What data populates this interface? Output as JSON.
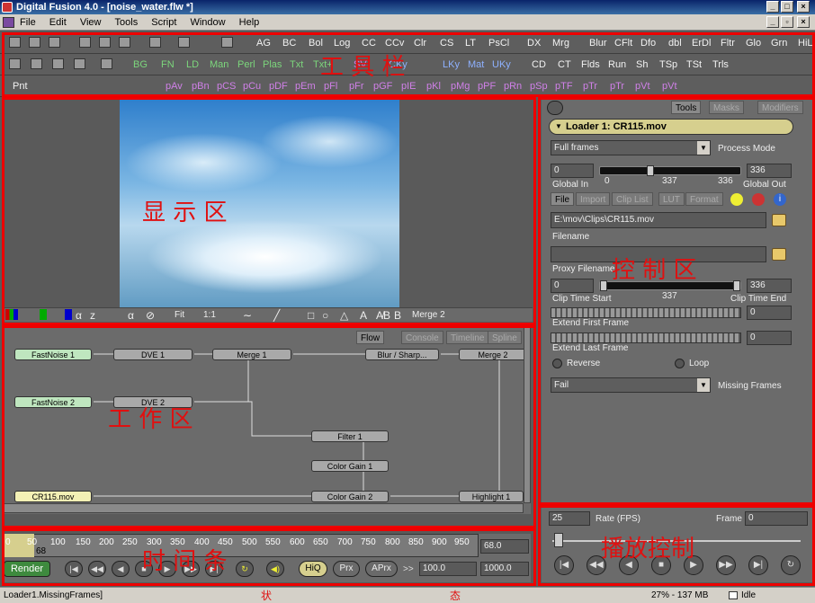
{
  "window": {
    "title": "Digital Fusion 4.0 - [noise_water.flw *]"
  },
  "menu": [
    "File",
    "Edit",
    "View",
    "Tools",
    "Script",
    "Window",
    "Help"
  ],
  "toolbar1": [
    "AG",
    "BC",
    "Bol",
    "Log",
    "CC",
    "CCv",
    "Clr",
    "CS",
    "LT",
    "PsCl",
    "DX",
    "Mrg",
    "Blur",
    "CFlt",
    "Dfo",
    "dbl",
    "ErDl",
    "Fltr",
    "Glo",
    "Grn",
    "HiL"
  ],
  "toolbar2": [
    "BG",
    "FN",
    "LD",
    "Man",
    "Perl",
    "Plas",
    "Txt",
    "Txt+",
    "SV",
    "CKy",
    "LKy",
    "Mat",
    "UKy",
    "CD",
    "CT",
    "Flds",
    "Run",
    "Sh",
    "TSp",
    "TSt",
    "Trls"
  ],
  "toolbar3": [
    "Pnt",
    "pAv",
    "pBn",
    "pCS",
    "pCu",
    "pDF",
    "pEm",
    "pFl",
    "pFr",
    "pGF",
    "pIE",
    "pKl",
    "pMg",
    "pPF",
    "pRn",
    "pSp",
    "pTF",
    "pTr",
    "pTr",
    "pVt",
    "pVt"
  ],
  "annotations": {
    "toolbar": "工  具  栏",
    "viewer": "显    示    区",
    "control": "控  制  区",
    "flow": "工    作    区",
    "timeline": "时    间    条",
    "playback": "播放控制",
    "status": "状",
    "status2": "态"
  },
  "viewer": {
    "zoom": "Fit",
    "ratio": "1:1",
    "node_label": "Merge 2"
  },
  "flow": {
    "tabs": [
      "Flow",
      "Console",
      "Timeline",
      "Spline"
    ],
    "nodes": [
      "FastNoise 1",
      "DVE 1",
      "Merge 1",
      "Blur / Sharp...",
      "Merge 2",
      "FastNoise 2",
      "DVE 2",
      "Filter 1",
      "Color Gain 1",
      "CR115.mov",
      "Color Gain 2",
      "Highlight 1"
    ]
  },
  "control": {
    "tabs": [
      "Tools",
      "Masks",
      "Modifiers"
    ],
    "header": "Loader 1: CR115.mov",
    "process_mode_value": "Full frames",
    "process_mode_label": "Process Mode",
    "global_in_value": "0",
    "global_out_value": "336",
    "global_in_label": "Global In",
    "global_out_label": "Global Out",
    "slider_min": "0",
    "slider_mid": "337",
    "slider_max": "336",
    "subtabs": [
      "File",
      "Import",
      "Clip List",
      "LUT",
      "Format"
    ],
    "filename_value": "E:\\mov\\Clips\\CR115.mov",
    "filename_label": "Filename",
    "proxy_label": "Proxy Filename",
    "clip_start_value": "0",
    "clip_end_value": "336",
    "clip_mid": "337",
    "clip_start_label": "Clip Time Start",
    "clip_end_label": "Clip Time End",
    "extend_first_value": "0",
    "extend_first_label": "Extend First Frame",
    "extend_last_value": "0",
    "extend_last_label": "Extend Last Frame",
    "reverse_label": "Reverse",
    "loop_label": "Loop",
    "missing_value": "Fail",
    "missing_label": "Missing Frames"
  },
  "timeline": {
    "ticks": [
      "0",
      "50",
      "100",
      "150",
      "200",
      "250",
      "300",
      "350",
      "400",
      "450",
      "500",
      "550",
      "600",
      "650",
      "700",
      "750",
      "800",
      "850",
      "900",
      "950"
    ],
    "marker": "68",
    "current": "68.0",
    "render_label": "Render",
    "hiq": "HiQ",
    "prx": "Prx",
    "aprx": "APrx",
    "arrows": ">>",
    "start": "100.0",
    "end": "1000.0"
  },
  "playback": {
    "rate_value": "25",
    "rate_label": "Rate (FPS)",
    "frame_label": "Frame",
    "frame_value": "0"
  },
  "status": {
    "left": "Loader1.MissingFrames]",
    "memory": "27% - 137 MB",
    "state": "Idle"
  }
}
